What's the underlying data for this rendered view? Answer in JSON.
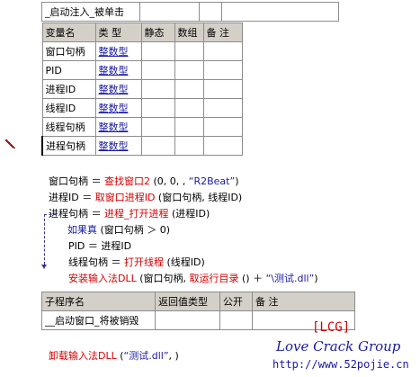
{
  "event_table": {
    "name": "_启动注入_被单击"
  },
  "var_table": {
    "headers": [
      "变量名",
      "类 型",
      "静态",
      "数组",
      "备 注"
    ],
    "rows": [
      {
        "name": "窗口句柄",
        "type": "整数型"
      },
      {
        "name": "PID",
        "type": "整数型"
      },
      {
        "name": "进程ID",
        "type": "整数型"
      },
      {
        "name": "线程ID",
        "type": "整数型"
      },
      {
        "name": "线程句柄",
        "type": "整数型"
      },
      {
        "name": "进程句柄",
        "type": "整数型"
      }
    ]
  },
  "code": {
    "line1": {
      "lhs": "窗口句柄 ＝ ",
      "fn": "查找窗口2",
      "args": " (0, 0, , ",
      "str": "“R2Beat”",
      "end": ")"
    },
    "line2": {
      "lhs": "进程ID ＝ ",
      "fn": "取窗口进程ID",
      "args": " (窗口句柄, 线程ID)"
    },
    "line3": {
      "lhs": "进程句柄 ＝ ",
      "fn": "进程_打开进程",
      "args": " (进程ID)"
    },
    "line4": {
      "kw": "如果真",
      "args": " (窗口句柄 ＞ 0)"
    },
    "line5": {
      "text": "PID ＝ 进程ID"
    },
    "line6": {
      "lhs": "线程句柄 ＝ ",
      "fn": "打开线程",
      "args": " (线程ID)"
    },
    "line7": {
      "fn": "安装输入法DLL",
      "args": " (窗口句柄, ",
      "fn2": "取运行目录",
      "args2": " () ＋ ",
      "str": "“\\测试.dll”",
      "end": ")"
    }
  },
  "sub_table": {
    "headers": [
      "子程序名",
      "返回值类型",
      "公开",
      "备 注"
    ],
    "name": "__启动窗口_将被销毁"
  },
  "code2": {
    "fn": "卸载输入法DLL",
    "args": " (",
    "str": "“测试.dll”",
    "end": ", )"
  },
  "watermark": {
    "tag": "[LCG]",
    "name": "Love Crack Group",
    "url": "http://www.52pojie.cn"
  },
  "colors": {
    "keyword": "#d40000",
    "flow": "#1a1aa6",
    "header_bg": "#d4d0c8"
  }
}
